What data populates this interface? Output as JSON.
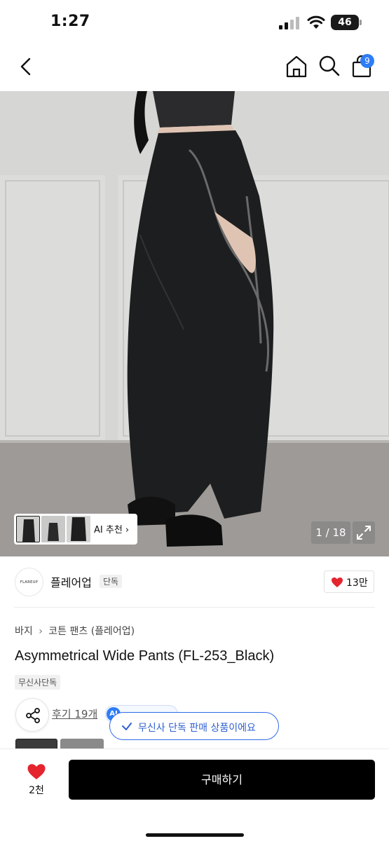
{
  "status_bar": {
    "time": "1:27",
    "battery": "46"
  },
  "nav": {
    "cart_count": "9"
  },
  "gallery": {
    "counter": "1 / 18",
    "ai_recommend": "AI 추천"
  },
  "brand": {
    "logo_text": "FLAREUP",
    "name": "플레어업",
    "tag": "단독",
    "like_count": "13만"
  },
  "category": {
    "parent": "바지",
    "child": "코튼 팬츠 (플레어업)"
  },
  "product": {
    "title": "Asymmetrical Wide Pants (FL-253_Black)",
    "exclusive_tag": "무신사단독"
  },
  "reviews": {
    "label": "후기 19개",
    "ai_badge": "AI",
    "ai_text": "AI 요약보기"
  },
  "toast": {
    "message": "무신사 단독 판매 상품이에요"
  },
  "bottom": {
    "favorite_count": "2천",
    "buy_label": "구매하기"
  },
  "colors": {
    "accent": "#2f7df6",
    "heart": "#e5242d",
    "buy_bg": "#000000"
  },
  "icons": [
    "back-arrow-icon",
    "home-icon",
    "search-icon",
    "shopping-bag-icon",
    "expand-icon",
    "share-icon",
    "heart-icon",
    "check-icon"
  ]
}
